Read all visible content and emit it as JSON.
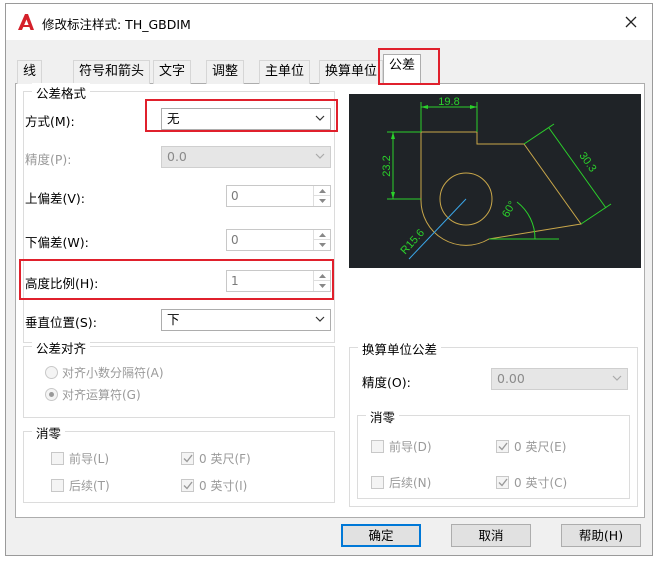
{
  "window": {
    "title": "修改标注样式: TH_GBDIM"
  },
  "tabs": [
    "线",
    "符号和箭头",
    "文字",
    "调整",
    "主单位",
    "换算单位",
    "公差"
  ],
  "tolerance_format": {
    "group_label": "公差格式",
    "method_label": "方式(M):",
    "method_value": "无",
    "precision_label": "精度(P):",
    "precision_value": "0.0",
    "upper_label": "上偏差(V):",
    "upper_value": "0",
    "lower_label": "下偏差(W):",
    "lower_value": "0",
    "height_label": "高度比例(H):",
    "height_value": "1",
    "vpos_label": "垂直位置(S):",
    "vpos_value": "下"
  },
  "alignment": {
    "group_label": "公差对齐",
    "option1": "对齐小数分隔符(A)",
    "option2": "对齐运算符(G)"
  },
  "zero_suppression": {
    "group_label": "消零",
    "leading": "前导(L)",
    "trailing": "后续(T)",
    "feet": "0 英尺(F)",
    "inches": "0 英寸(I)"
  },
  "alt_tolerance": {
    "group_label": "换算单位公差",
    "precision_label": "精度(O):",
    "precision_value": "0.00",
    "zero_group_label": "消零",
    "leading": "前导(D)",
    "trailing": "后续(N)",
    "feet": "0 英尺(E)",
    "inches": "0 英寸(C)"
  },
  "preview": {
    "dim_top": "19.8",
    "dim_left": "23.2",
    "dim_right": "30.3",
    "dim_angle": "60°",
    "dim_radius": "R15.6"
  },
  "buttons": {
    "ok": "确定",
    "cancel": "取消",
    "help": "帮助(H)"
  },
  "colors": {
    "highlight": "#e0202c",
    "preview_bg": "#1f2327",
    "preview_dim": "#2bd12b",
    "preview_geom": "#c9a74a",
    "preview_center": "#3aa6e8"
  }
}
